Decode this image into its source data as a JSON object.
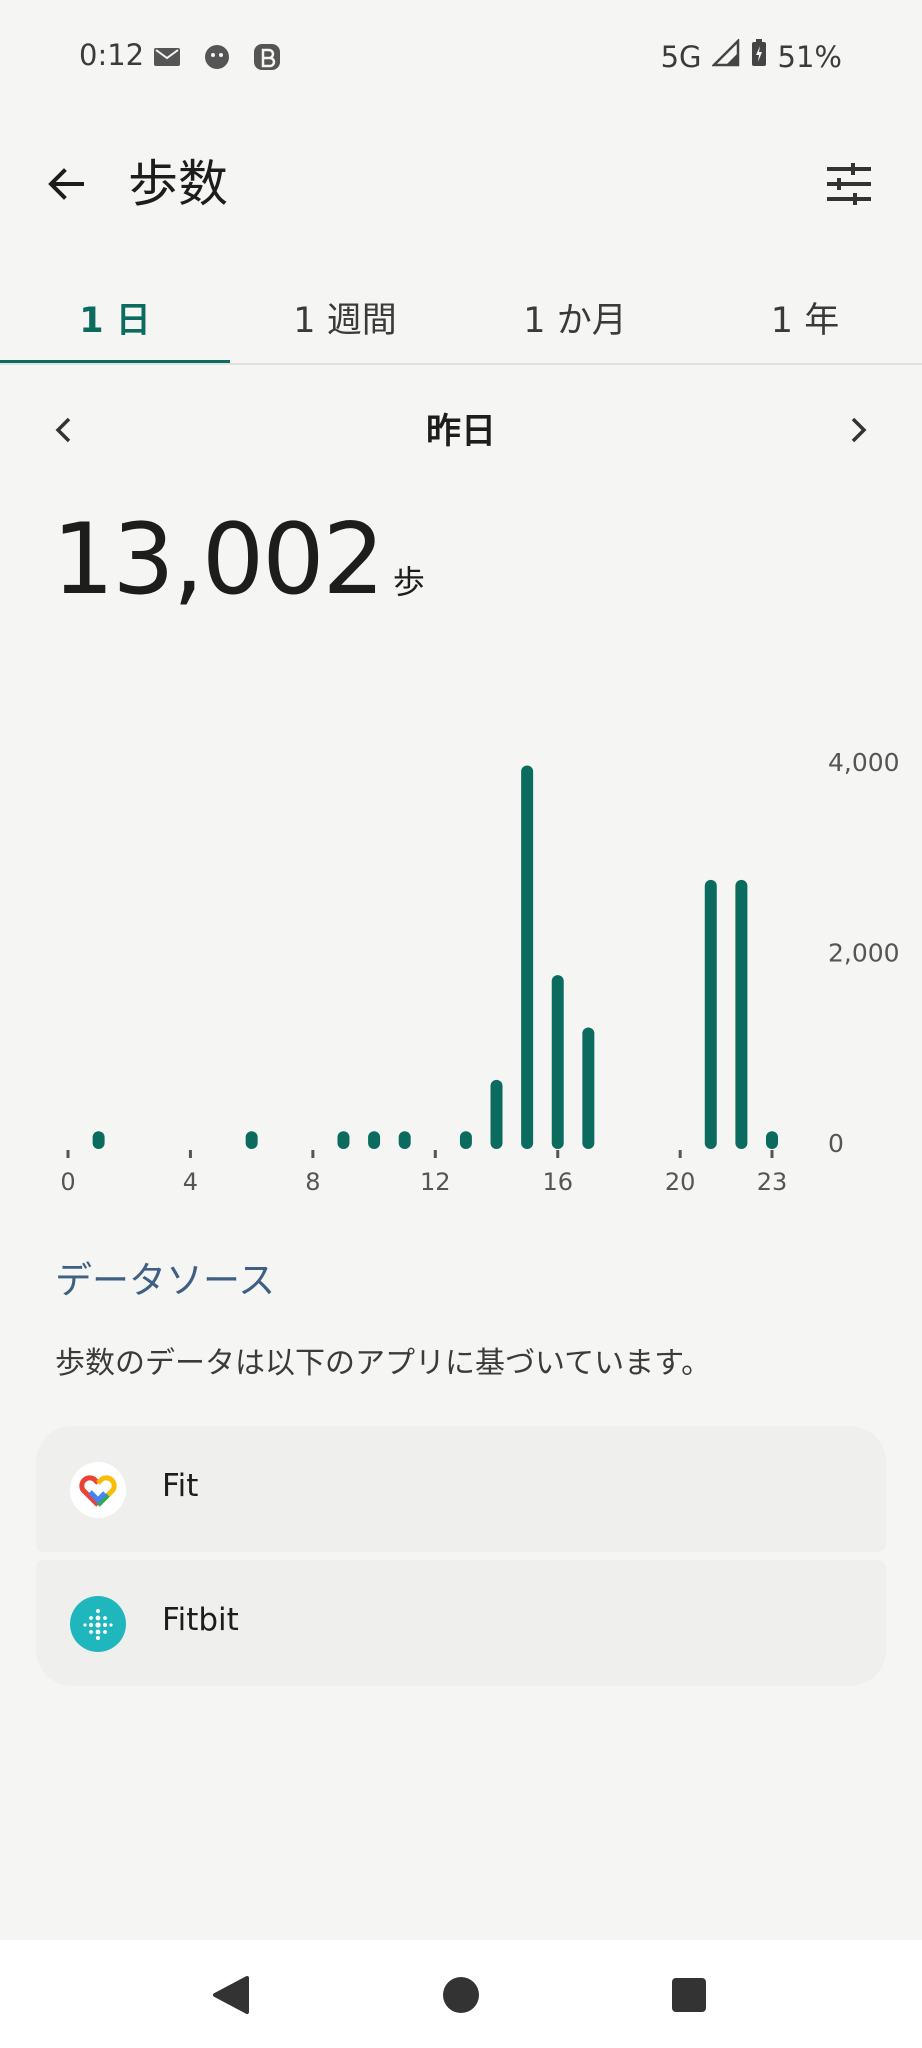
{
  "status_bar": {
    "time": "0:12",
    "network": "5G",
    "battery": "51%"
  },
  "header": {
    "title": "歩数",
    "back_icon": "arrow-back-icon",
    "filter_icon": "tune-icon"
  },
  "tabs": [
    {
      "label": "1 日",
      "active": true
    },
    {
      "label": "1 週間",
      "active": false
    },
    {
      "label": "1 か月",
      "active": false
    },
    {
      "label": "1 年",
      "active": false
    }
  ],
  "date_nav": {
    "label": "昨日"
  },
  "summary": {
    "total": "13,002",
    "unit": "歩"
  },
  "chart_data": {
    "type": "bar",
    "x": [
      0,
      1,
      2,
      3,
      4,
      5,
      6,
      7,
      8,
      9,
      10,
      11,
      12,
      13,
      14,
      15,
      16,
      17,
      18,
      19,
      20,
      21,
      22,
      23
    ],
    "values": [
      0,
      60,
      0,
      0,
      0,
      0,
      60,
      0,
      0,
      60,
      60,
      60,
      0,
      60,
      600,
      3900,
      1700,
      1150,
      0,
      0,
      0,
      2700,
      2700,
      60
    ],
    "xticks": [
      "0",
      "4",
      "8",
      "12",
      "16",
      "20",
      "23"
    ],
    "xtick_values": [
      0,
      4,
      8,
      12,
      16,
      20,
      23
    ],
    "yticks": [
      "0",
      "2,000",
      "4,000"
    ],
    "ytick_values": [
      0,
      2000,
      4000
    ],
    "ylim": [
      0,
      4000
    ],
    "color": "#0b6b5f"
  },
  "data_source": {
    "title": "データソース",
    "description": "歩数のデータは以下のアプリに基づいています。",
    "sources": [
      {
        "name": "Fit",
        "icon": "google-fit-heart-icon"
      },
      {
        "name": "Fitbit",
        "icon": "fitbit-dots-icon"
      }
    ]
  },
  "colors": {
    "accent": "#0b6b5f",
    "section_title": "#3f5f83",
    "background": "#f5f6f3"
  }
}
